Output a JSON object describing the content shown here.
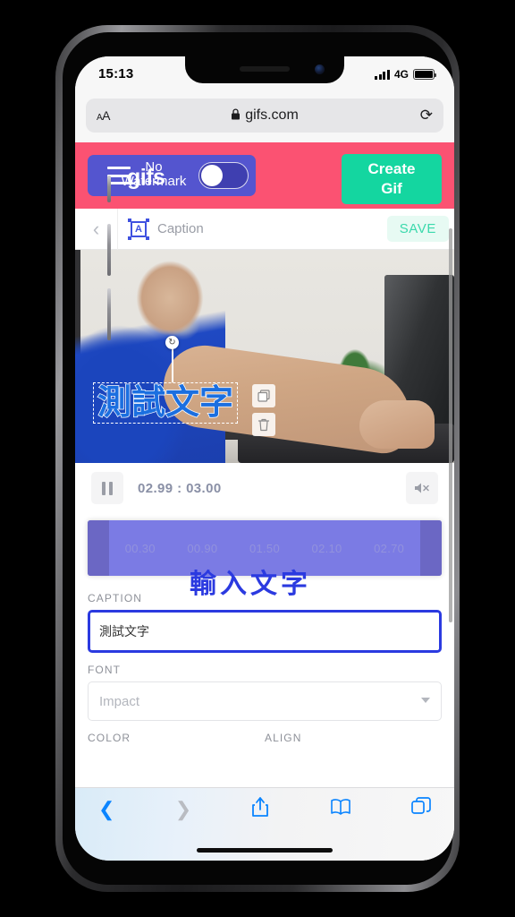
{
  "status_bar": {
    "time": "15:13",
    "network": "4G",
    "signal_icon": "signal-bars-icon",
    "battery_icon": "battery-full-icon"
  },
  "browser": {
    "aa_button": "AA",
    "lock_icon": "lock-icon",
    "url": "gifs.com",
    "reload_icon": "reload-icon",
    "toolbar": {
      "back_icon": "chevron-left-icon",
      "forward_icon": "chevron-right-icon",
      "share_icon": "share-icon",
      "bookmarks_icon": "book-icon",
      "tabs_icon": "tabs-icon"
    }
  },
  "app_header": {
    "menu_icon": "hamburger-menu-icon",
    "brand": "gifs",
    "watermark_label": "No\nWatermark",
    "watermark_toggle_state": "on",
    "create_button": "Create\nGif",
    "background_color": "#fb5272",
    "create_button_color": "#14d6a0",
    "nav_chip_color": "#5455cf"
  },
  "caption_toolbar": {
    "back_icon": "chevron-left-icon",
    "tool_icon": "text-box-icon",
    "tool_icon_letter": "A",
    "title": "Caption",
    "save_label": "SAVE",
    "save_text_color": "#3ad9ac"
  },
  "video_preview": {
    "overlay_text": "測試文字",
    "overlay_text_color": "#1b6fe0",
    "rotate_icon": "rotate-handle-icon",
    "copy_icon": "copy-icon",
    "delete_icon": "trash-icon"
  },
  "playback": {
    "pause_icon": "pause-icon",
    "current_time": "02.99",
    "time_separator": ":",
    "total_time": "03.00",
    "time_display": "02.99 : 03.00",
    "mute_icon": "mute-icon"
  },
  "timeline": {
    "ticks": [
      "00.30",
      "00.90",
      "01.50",
      "02.10",
      "02.70"
    ],
    "track_color": "#7b7be4",
    "handle_color": "#6b67c4"
  },
  "form": {
    "caption_label": "CAPTION",
    "caption_value": "測試文字",
    "font_label": "FONT",
    "font_value": "Impact",
    "font_caret_icon": "chevron-down-icon",
    "color_label": "COLOR",
    "align_label": "ALIGN"
  },
  "annotations": {
    "input_text_note": "輸入文字",
    "note_color": "#2b3ae0"
  }
}
